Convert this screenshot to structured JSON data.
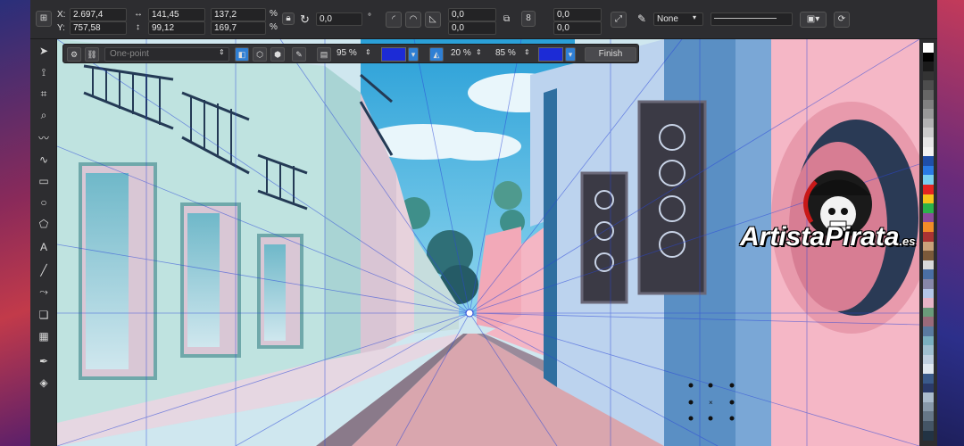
{
  "propbar": {
    "x_label": "X:",
    "x_value": "2.697,4",
    "y_label": "Y:",
    "y_value": "757,58",
    "width_value": "141,45",
    "height_value": "99,12",
    "scale_w": "137,2",
    "scale_h": "169,7",
    "percent": "%",
    "rotation": "0,0",
    "degree": "°",
    "pos_x2": "0,0",
    "pos_y2": "0,0",
    "corner_count": "8",
    "corner_a": "0,0",
    "corner_b": "0,0",
    "fill_select": "None"
  },
  "perspective_toolbar": {
    "mode_select_placeholder": "One-point",
    "opacity_1": "95 %",
    "opacity_2": "20 %",
    "opacity_3": "85 %",
    "finish_button": "Finish",
    "color_1": "#1c2bd6",
    "color_2": "#1c2bd6"
  },
  "watermark": {
    "text": "ArtistaPirata",
    "suffix": ".es"
  },
  "palette_colors": [
    "#ffffff",
    "#000000",
    "#1a1a1a",
    "#333333",
    "#4d4d4d",
    "#666666",
    "#808080",
    "#999999",
    "#b3b3b3",
    "#cccccc",
    "#e6e6e6",
    "#f2f2f2",
    "#1f4fa8",
    "#2a7be4",
    "#7ad0f0",
    "#e52421",
    "#f7c31a",
    "#2bb34a",
    "#8d4a9c",
    "#f28c28",
    "#a33",
    "#c9a27a",
    "#7b5a3a",
    "#d9d9d9",
    "#4a6fa5",
    "#88a",
    "#b4c6e7",
    "#e7b4c6",
    "#6a9a7a",
    "#9a6a7a",
    "#5a7aa0",
    "#7ab0c0",
    "#a0c0d0",
    "#c0d0e0",
    "#e0e8f0",
    "#3a5a8a",
    "#2a3a6a",
    "#aabbcc",
    "#8899aa",
    "#667788",
    "#445566",
    "#223344"
  ],
  "tools": [
    "pick-icon",
    "shape-icon",
    "crop-icon",
    "zoom-icon",
    "freehand-icon",
    "artistic-icon",
    "rectangle-icon",
    "ellipse-icon",
    "polygon-icon",
    "text-icon",
    "dimension-icon",
    "connector-icon",
    "shadow-icon",
    "transparency-icon",
    "eyedropper-icon",
    "fill-icon"
  ]
}
